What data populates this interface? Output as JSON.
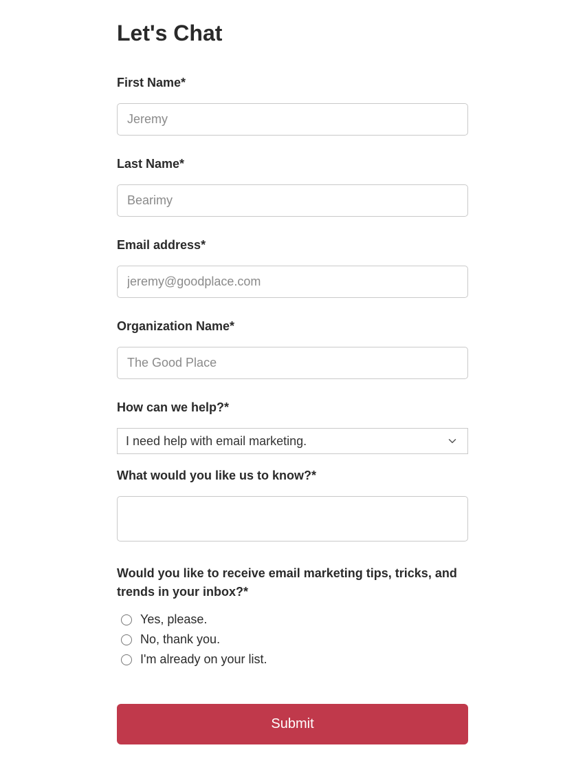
{
  "title": "Let's Chat",
  "fields": {
    "first_name": {
      "label": "First Name*",
      "placeholder": "Jeremy",
      "value": ""
    },
    "last_name": {
      "label": "Last Name*",
      "placeholder": "Bearimy",
      "value": ""
    },
    "email": {
      "label": "Email address*",
      "placeholder": "jeremy@goodplace.com",
      "value": ""
    },
    "organization": {
      "label": "Organization Name*",
      "placeholder": "The Good Place",
      "value": ""
    },
    "help": {
      "label": "How can we help?*",
      "selected": "I need help with email marketing."
    },
    "message": {
      "label": "What would you like us to know?*",
      "value": ""
    },
    "subscribe": {
      "label": "Would you like to receive email marketing tips, tricks, and trends in your inbox?*",
      "options": [
        "Yes, please.",
        "No, thank you.",
        "I'm already on your list."
      ]
    }
  },
  "submit_label": "Submit",
  "colors": {
    "primary": "#c0394b"
  }
}
